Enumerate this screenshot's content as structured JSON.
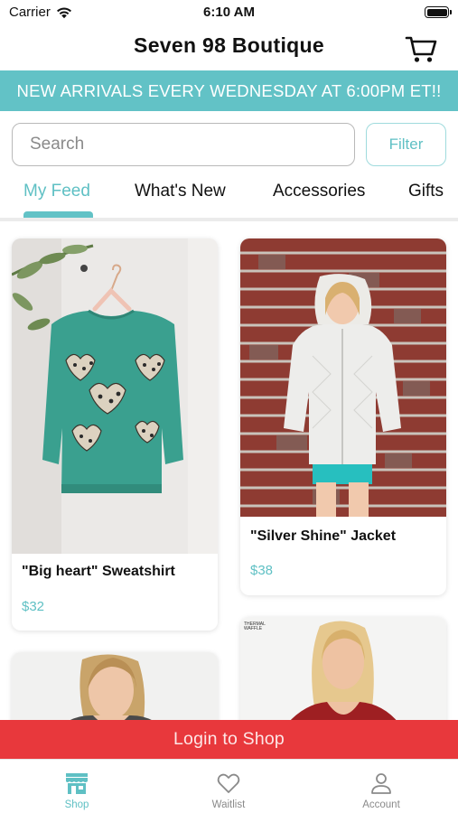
{
  "status_bar": {
    "carrier": "Carrier",
    "time": "6:10 AM"
  },
  "header": {
    "title": "Seven 98 Boutique",
    "cart_icon": "cart-icon"
  },
  "banner": {
    "text": "NEW ARRIVALS EVERY WEDNESDAY AT 6:00PM ET!!"
  },
  "search": {
    "placeholder": "Search",
    "value": "",
    "filter_label": "Filter"
  },
  "tabs": [
    {
      "label": "My Feed",
      "active": true
    },
    {
      "label": "What's New",
      "active": false
    },
    {
      "label": "Accessories",
      "active": false
    },
    {
      "label": "Gifts",
      "active": false
    }
  ],
  "products": [
    {
      "name": "\"Big heart\" Sweatshirt",
      "price": "$32"
    },
    {
      "name": "\"Silver Shine\" Jacket",
      "price": "$38"
    },
    {
      "name": "",
      "price": ""
    },
    {
      "name": "",
      "price": "",
      "image_tag": "THERMAL WAFFLE"
    }
  ],
  "login_bar": {
    "label": "Login to Shop"
  },
  "tabbar": [
    {
      "label": "Shop",
      "icon": "storefront-icon",
      "active": true
    },
    {
      "label": "Waitlist",
      "icon": "heart-icon",
      "active": false
    },
    {
      "label": "Account",
      "icon": "person-icon",
      "active": false
    }
  ],
  "colors": {
    "accent": "#62c2c6",
    "login_bar": "#e8383c",
    "price": "#5fc0c4"
  }
}
